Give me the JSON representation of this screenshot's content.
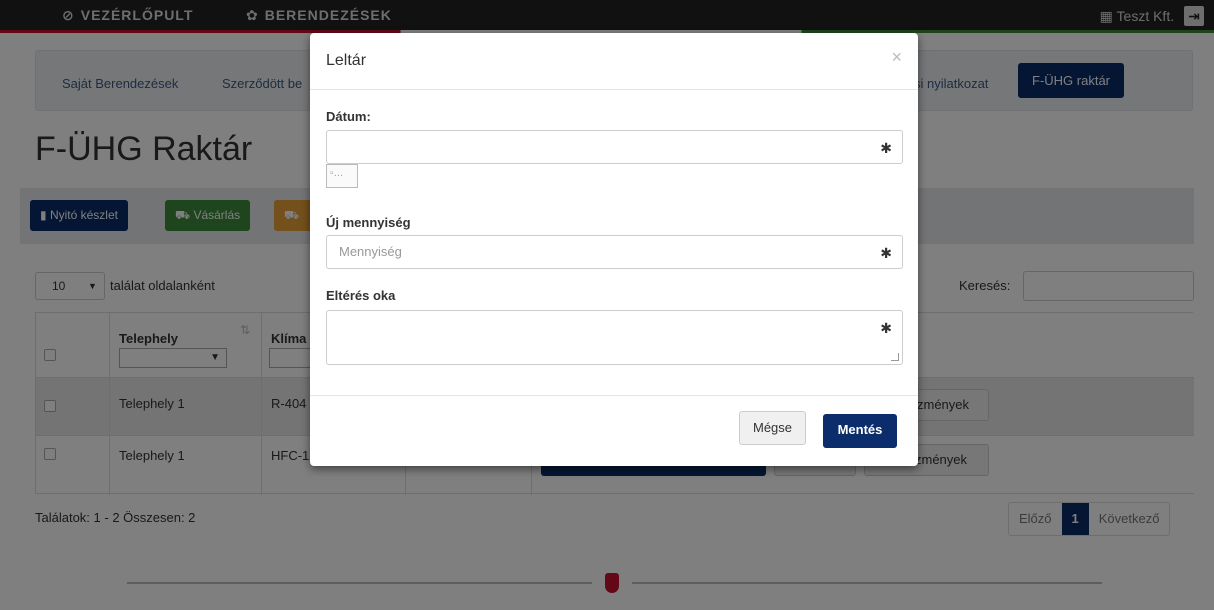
{
  "nav": {
    "dashboard_label": "VEZÉRLŐPULT",
    "devices_label": "BERENDEZÉSEK",
    "company_label": "Teszt Kft."
  },
  "tabs": {
    "own": "Saját Berendezések",
    "contracted": "Szerződött be",
    "declaration": "si nyilatkozat",
    "warehouse": "F-ÜHG raktár"
  },
  "page": {
    "title": "F-ÜHG Raktár"
  },
  "toolbar": {
    "opening_stock": "Nyitó készlet",
    "purchase": "Vásárlás"
  },
  "list": {
    "page_size": "10",
    "page_size_label": "találat oldalanként",
    "search_label": "Keresés:"
  },
  "table": {
    "col_site": "Telephely",
    "col_refrigerant": "Klíma",
    "rows": [
      {
        "site": "Telephely 1",
        "refrigerant": "R-404",
        "events_label": "zmények"
      },
      {
        "site": "Telephely 1",
        "refrigerant": "HFC-1",
        "events_label": "zmények"
      }
    ]
  },
  "results": {
    "summary": "Találatok: 1 - 2 Összesen: 2"
  },
  "pager": {
    "prev": "Előző",
    "current": "1",
    "next": "Következő"
  },
  "modal": {
    "title": "Leltár",
    "close": "×",
    "date_label": "Dátum:",
    "date_value": "",
    "new_qty_label": "Új mennyiség",
    "new_qty_placeholder": "Mennyiség",
    "reason_label": "Eltérés oka",
    "reason_value": "",
    "required_mark": "✱",
    "cancel_label": "Mégse",
    "save_label": "Mentés"
  },
  "colors": {
    "primary": "#0b2d6b",
    "success": "#3c8a3c",
    "warning": "#e8a03a"
  }
}
